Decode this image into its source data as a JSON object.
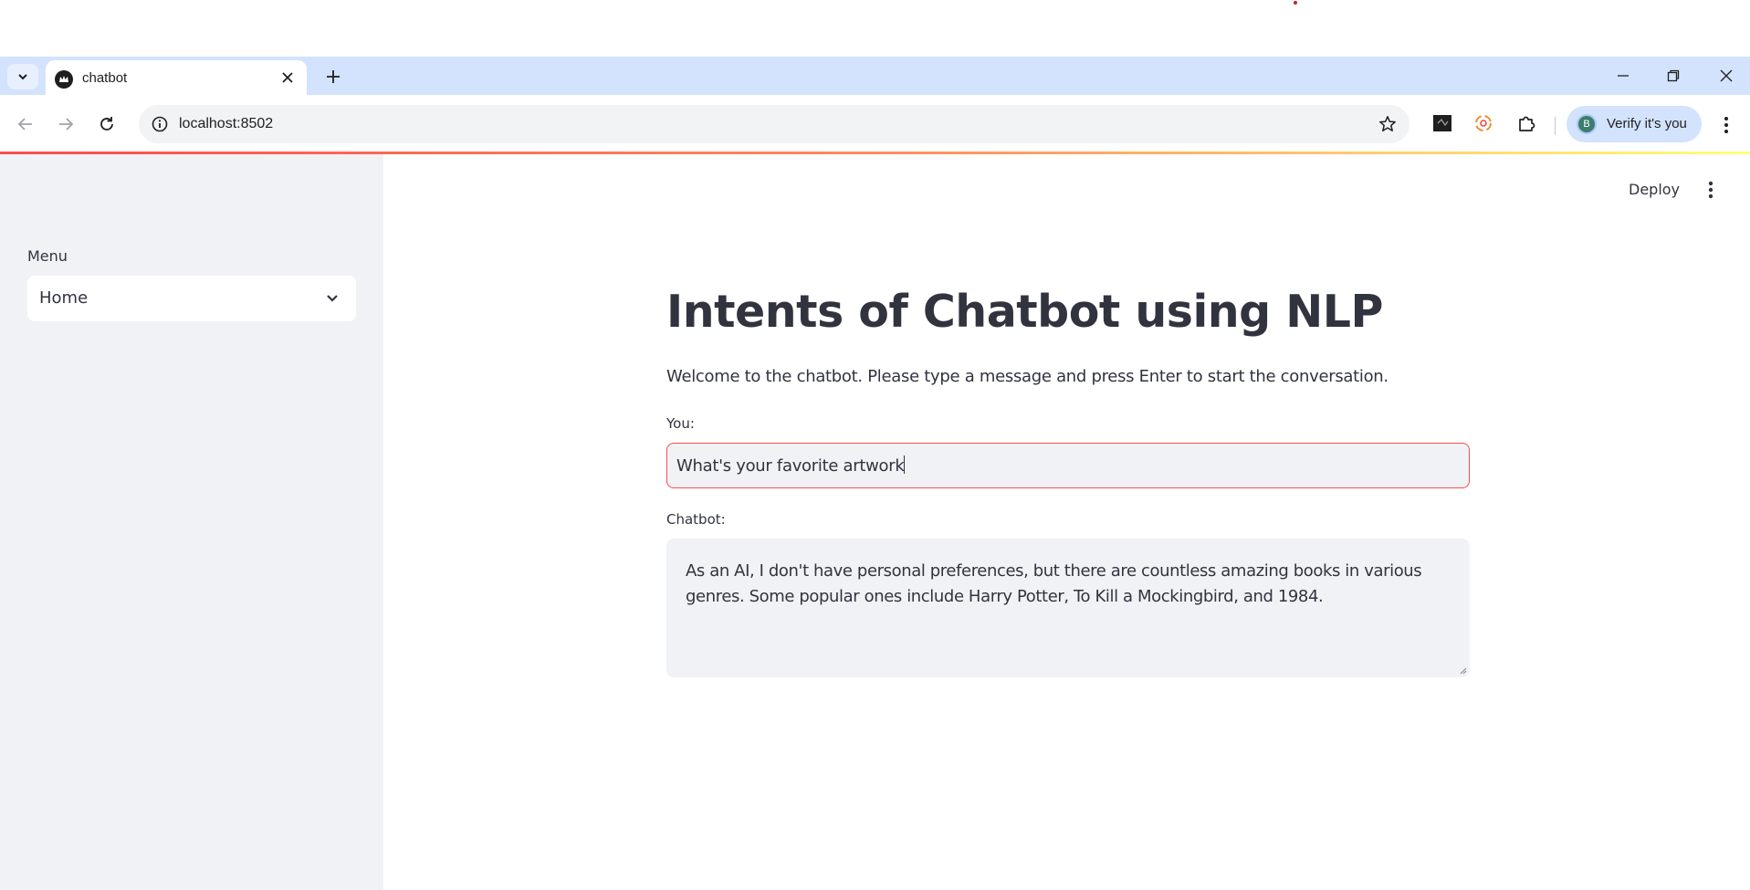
{
  "browser": {
    "tab": {
      "title": "chatbot"
    },
    "address": {
      "url": "localhost:8502"
    },
    "profile": {
      "button_label": "Verify it's you",
      "avatar_letter": "B"
    }
  },
  "app": {
    "header": {
      "deploy_label": "Deploy"
    },
    "sidebar": {
      "menu_label": "Menu",
      "menu_selected": "Home"
    },
    "main": {
      "title": "Intents of Chatbot using NLP",
      "welcome": "Welcome to the chatbot. Please type a message and press Enter to start the conversation.",
      "you_label": "You:",
      "you_value": "What's your favorite artwork",
      "chatbot_label": "Chatbot:",
      "chatbot_response": "As an AI, I don't have personal preferences, but there are countless amazing books in various genres. Some popular ones include Harry Potter, To Kill a Mockingbird, and 1984."
    }
  },
  "colors": {
    "accent": "#ff4b4b",
    "sidebar_bg": "#f0f2f6",
    "text": "#31333f",
    "tabbar_bg": "#d3e3fd"
  }
}
